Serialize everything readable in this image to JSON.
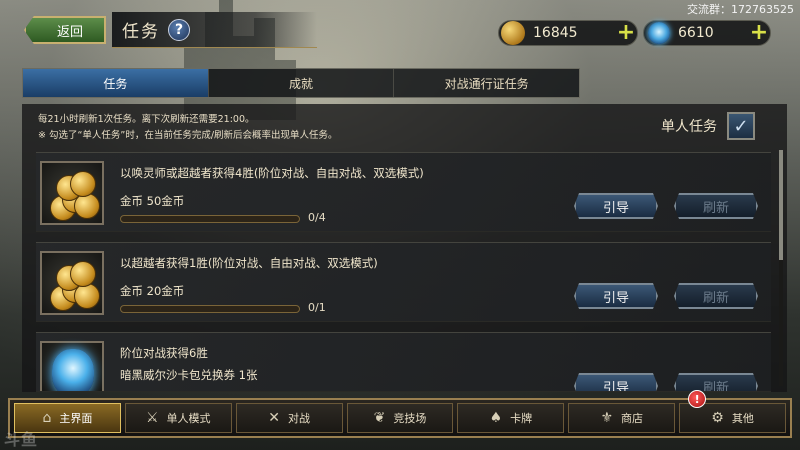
{
  "header": {
    "back_label": "返回",
    "title": "任务",
    "help_symbol": "?",
    "qq_group": "交流群：172763525"
  },
  "currency": {
    "gold": {
      "value": "16845",
      "icon": "gold-coin-icon",
      "plus": "+"
    },
    "crystal": {
      "value": "6610",
      "icon": "blue-crystal-icon",
      "plus": "+"
    }
  },
  "tabs": [
    {
      "label": "任务",
      "active": true
    },
    {
      "label": "成就",
      "active": false
    },
    {
      "label": "对战通行证任务",
      "active": false
    }
  ],
  "notice": {
    "line1": "每21小时刷新1次任务。离下次刷新还需要21:00。",
    "line2": "※ 勾选了“单人任务”时，在当前任务完成/刷新后会概率出现单人任务。"
  },
  "single_task": {
    "label": "单人任务",
    "checked": true,
    "check_symbol": "✓"
  },
  "tasks": [
    {
      "title": "以唤灵师或超越者获得4胜(阶位对战、自由对战、双选模式)",
      "reward": "金币  50金币",
      "progress": "0/4",
      "progress_fraction": 0,
      "guide_label": "引导",
      "refresh_label": "刷新",
      "icon": "gold-coins-icon"
    },
    {
      "title": "以超越者获得1胜(阶位对战、自由对战、双选模式)",
      "reward": "金币  20金币",
      "progress": "0/1",
      "progress_fraction": 0,
      "guide_label": "引导",
      "refresh_label": "刷新",
      "icon": "gold-coins-icon"
    },
    {
      "title": "阶位对战获得6胜",
      "reward": "暗黑威尔沙卡包兑换券 1张",
      "guide_label": "引导",
      "refresh_label": "刷新",
      "icon": "card-pack-orb-icon"
    }
  ],
  "bottom_nav": [
    {
      "label": "主界面",
      "icon": "home-icon",
      "glyph": "⌂",
      "active": true
    },
    {
      "label": "单人模式",
      "icon": "sword-icon",
      "glyph": "⚔",
      "active": false
    },
    {
      "label": "对战",
      "icon": "crossed-swords-icon",
      "glyph": "✕",
      "active": false
    },
    {
      "label": "竞技场",
      "icon": "laurel-icon",
      "glyph": "❦",
      "active": false
    },
    {
      "label": "卡牌",
      "icon": "cards-icon",
      "glyph": "♠",
      "active": false
    },
    {
      "label": "商店",
      "icon": "shop-icon",
      "glyph": "⚜",
      "active": false
    },
    {
      "label": "其他",
      "icon": "gear-icon",
      "glyph": "⚙",
      "active": false,
      "badge": "!"
    }
  ],
  "watermark": "斗鱼"
}
